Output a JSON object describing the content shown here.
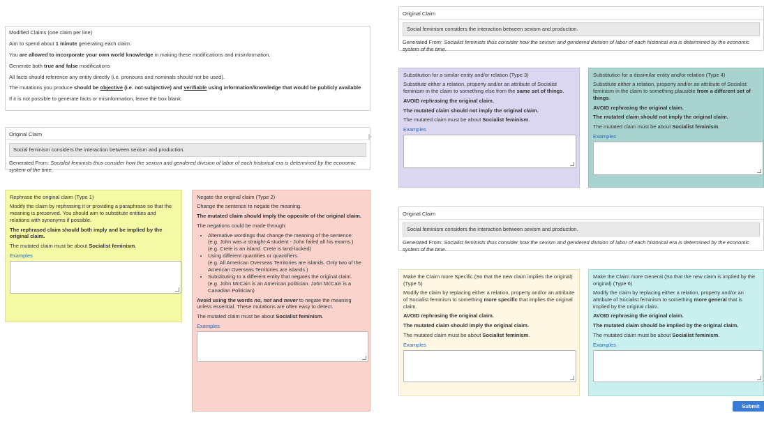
{
  "instructions": {
    "title": "Modified Claims (one claim per line)",
    "l1_pre": "Aim to spend about ",
    "l1_bold": "1 minute",
    "l1_post": " generating each claim.",
    "l2_pre": "You ",
    "l2_bold": "are allowed to incorporate your own world knowledge",
    "l2_post": " in making these modifications and misinformation.",
    "l3_pre": "Generate both ",
    "l3_bold": "true and false",
    "l3_post": " modifications",
    "l4": "All facts should reference any entity directly (i.e. pronouns and nominals should not be used).",
    "l5_pre": "The mutations you produce ",
    "l5_b1": "should be ",
    "l5_u1": "objective",
    "l5_b2": " (i.e. not subjective) and ",
    "l5_u2": "verifiable",
    "l5_b3": " using information/knowledge that would be publicly available",
    "l6": "If it is not possible to generate facts or misinformation, leave the box blank."
  },
  "claim": {
    "label": "Original Claim",
    "text": "Social feminism considers the interaction between sexism and production.",
    "gen_label": "Generated From: ",
    "gen_text": "Socialist feminists thus consider how the sexism and gendered division of labor of each historical era is determined by the economic system of the time."
  },
  "type1": {
    "title": "Rephrase the original claim (Type 1)",
    "p1": "Modify the claim by rephrasing it or providing a paraphrase so that the meaning is preserved. You should aim to substitute entities and relations with synonyms if possible.",
    "p2": "The rephrased claim should both imply and be implied by the original claim.",
    "p3_pre": "The mutated claim must be about ",
    "p3_bold": "Socialist feminism",
    "p3_post": ".",
    "examples": "Examples"
  },
  "type2": {
    "title": "Negate the original claim (Type 2)",
    "p1": "Change the sentence to negate the meaning.",
    "p2": "The mutated claim should imply the opposite of the original claim.",
    "p3": "The negations could be made through:",
    "b1": "Alternative wordings that change the meaning of the sentence:",
    "b1e1": "(e.g. John was a straight-A student - John failed all his exams.)",
    "b1e2": "(e.g. Crete is an island. Crete is land-locked)",
    "b2": "Using different quantities or quantifiers:",
    "b2e1": "(e.g. All American Overseas Territories are islands. Only two of the American Overseas Territories are islands.)",
    "b3": "Substituting to a different entity that negates the original claim.",
    "b3e1": "(e.g. John McCain is an American politician. John McCain is a Canadian Politician)",
    "p4_b1": "Avoid using the words ",
    "p4_i1": "no, not",
    "p4_b2": " and ",
    "p4_i2": "never",
    "p4_post": " to negate the meaning unless essential. These mutations are often easy to detect.",
    "p5_pre": "The mutated claim must be about ",
    "p5_bold": "Socialist feminism",
    "p5_post": ".",
    "examples": "Examples"
  },
  "type3": {
    "title": "Substitution for a similar entity and/or relation (Type 3)",
    "p1_pre": "Substitute either a relation, property and/or an attribute of Socialist feminism in the claim to something else from the ",
    "p1_bold": "same set of things",
    "p1_post": ".",
    "p2": "AVOID rephrasing the original claim.",
    "p3": "The mutated claim should not imply the original claim.",
    "p4_pre": "The mutated claim must be about ",
    "p4_bold": "Socialist feminism",
    "p4_post": ".",
    "examples": "Examples"
  },
  "type4": {
    "title": "Substitution for a dissimilar entity and/or relation (Type 4)",
    "p1_pre": "Substitute either a relation, property and/or an attribute of Socialist feminism in the claim to something plausible ",
    "p1_bold": "from a different set of things",
    "p1_post": ".",
    "p2": "AVOID rephrasing the original claim.",
    "p3": "The mutated claim should not imply the original claim.",
    "p4_pre": "The mutated claim must be about ",
    "p4_bold": "Socialist feminism",
    "p4_post": ".",
    "examples": "Examples"
  },
  "type5": {
    "title": "Make the Claim more Specific (So that the new claim implies the original) (Type 5)",
    "p1_pre": "Modify the claim by replacing either a relation, property and/or an attribute of Socialist feminism to something ",
    "p1_bold": "more specific",
    "p1_post": " that implies the original claim.",
    "p2": "AVOID rephrasing the original claim.",
    "p3": "The mutated claim should imply the original claim.",
    "p4_pre": "The mutated claim must be about ",
    "p4_bold": "Socialist feminism",
    "p4_post": ".",
    "examples": "Examples"
  },
  "type6": {
    "title": "Make the Claim more General (So that the new claim is implied by the original) (Type 6)",
    "p1_pre": "Modify the claim by replacing either a relation, property and/or an attribute of Socialist feminism to something ",
    "p1_bold": "more general",
    "p1_post": " that is implied by the original claim.",
    "p2": "AVOID rephrasing the original claim.",
    "p3": "The mutated claim should be implied by the original claim.",
    "p4_pre": "The mutated claim must be about ",
    "p4_bold": "Socialist feminism",
    "p4_post": ".",
    "examples": "Examples"
  },
  "submit_label": "Submit Claims"
}
